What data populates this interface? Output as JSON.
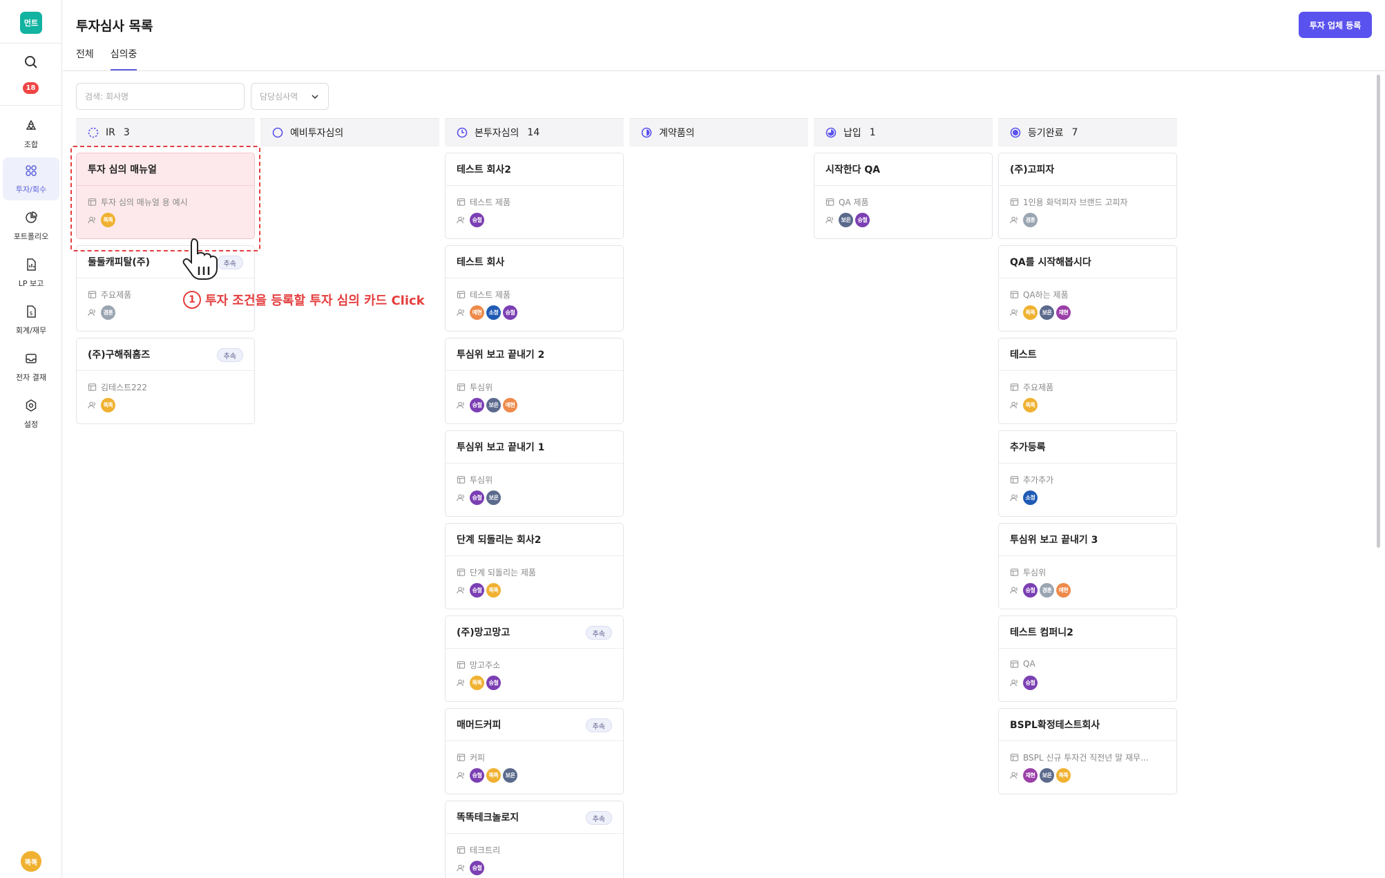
{
  "app": {
    "logo_text": "먼트",
    "notification_count": "18",
    "user_avatar": "똑똑"
  },
  "sidebar": {
    "items": [
      {
        "label": "조합",
        "icon": "recycle-icon",
        "active": false
      },
      {
        "label": "투자/회수",
        "icon": "network-icon",
        "active": true
      },
      {
        "label": "포트폴리오",
        "icon": "pie-chart-icon",
        "active": false
      },
      {
        "label": "LP 보고",
        "icon": "report-icon",
        "active": false
      },
      {
        "label": "회계/재무",
        "icon": "accounting-icon",
        "active": false
      },
      {
        "label": "전자 결재",
        "icon": "inbox-icon",
        "active": false
      },
      {
        "label": "설정",
        "icon": "gear-icon",
        "active": false
      }
    ]
  },
  "header": {
    "title": "투자심사 목록",
    "tabs": [
      {
        "label": "전체",
        "active": false
      },
      {
        "label": "심의중",
        "active": true
      }
    ],
    "primary_button": "투자 업체 등록"
  },
  "filters": {
    "search_placeholder": "검색: 회사명",
    "assignee_placeholder": "담당심사역"
  },
  "colors": {
    "accent": "#5a52ee",
    "annotation": "#e53d3d",
    "highlight_bg": "#fde9eb"
  },
  "columns": [
    {
      "name": "IR",
      "count": "3",
      "icon": "dashed-circle-icon",
      "cards": [
        {
          "title": "투자 심의 매뉴얼",
          "badge": "",
          "product": "투자 심의 매뉴얼 용 예시",
          "people": [
            "똑똑"
          ],
          "highlight": true
        },
        {
          "title": "둘둘캐피탈(주)",
          "badge": "추속",
          "product": "주요제품",
          "people": [
            "경훈"
          ],
          "highlight": false
        },
        {
          "title": "(주)구해줘홈즈",
          "badge": "추속",
          "product": "김테스트222",
          "people": [
            "똑똑"
          ],
          "highlight": false
        }
      ]
    },
    {
      "name": "예비투자심의",
      "count": "",
      "icon": "empty-circle-icon",
      "cards": []
    },
    {
      "name": "본투자심의",
      "count": "14",
      "icon": "clock-circle-icon",
      "cards": [
        {
          "title": "테스트 회사2",
          "badge": "",
          "product": "테스트 제품",
          "people": [
            "승철"
          ],
          "highlight": false
        },
        {
          "title": "테스트 회사",
          "badge": "",
          "product": "테스트 제품",
          "people": [
            "예현",
            "소정",
            "승철"
          ],
          "highlight": false
        },
        {
          "title": "투심위 보고 끝내기 2",
          "badge": "",
          "product": "투심위",
          "people": [
            "승철",
            "보은",
            "예현"
          ],
          "highlight": false
        },
        {
          "title": "투심위 보고 끝내기 1",
          "badge": "",
          "product": "투심위",
          "people": [
            "승철",
            "보은"
          ],
          "highlight": false
        },
        {
          "title": "단계 되돌리는 회사2",
          "badge": "",
          "product": "단계 되돌리는 제품",
          "people": [
            "승철",
            "똑똑"
          ],
          "highlight": false
        },
        {
          "title": "(주)망고망고",
          "badge": "추속",
          "product": "망고주소",
          "people": [
            "똑똑",
            "승철"
          ],
          "highlight": false
        },
        {
          "title": "매머드커피",
          "badge": "추속",
          "product": "커피",
          "people": [
            "승철",
            "똑똑",
            "보은"
          ],
          "highlight": false
        },
        {
          "title": "똑똑테크놀로지",
          "badge": "추속",
          "product": "테크트리",
          "people": [
            "승철"
          ],
          "highlight": false
        }
      ]
    },
    {
      "name": "계약품의",
      "count": "",
      "icon": "half-circle-icon",
      "cards": []
    },
    {
      "name": "납입",
      "count": "1",
      "icon": "three-quarter-circle-icon",
      "cards": [
        {
          "title": "시작한다 QA",
          "badge": "",
          "product": "QA 제품",
          "people": [
            "보은",
            "승철"
          ],
          "highlight": false
        }
      ]
    },
    {
      "name": "등기완료",
      "count": "7",
      "icon": "full-circle-icon",
      "cards": [
        {
          "title": "(주)고피자",
          "badge": "",
          "product": "1인용 화덕피자 브랜드 고피자",
          "people": [
            "경훈"
          ],
          "highlight": false
        },
        {
          "title": "QA를 시작해봅시다",
          "badge": "",
          "product": "QA하는 제품",
          "people": [
            "똑똑",
            "보은",
            "재현"
          ],
          "highlight": false
        },
        {
          "title": "테스트",
          "badge": "",
          "product": "주요제품",
          "people": [
            "똑똑"
          ],
          "highlight": false
        },
        {
          "title": "추가등록",
          "badge": "",
          "product": "추가추가",
          "people": [
            "소정"
          ],
          "highlight": false
        },
        {
          "title": "투심위 보고 끝내기 3",
          "badge": "",
          "product": "투심위",
          "people": [
            "승철",
            "경훈",
            "예현"
          ],
          "highlight": false
        },
        {
          "title": "테스트 컴퍼니2",
          "badge": "",
          "product": "QA",
          "people": [
            "승철"
          ],
          "highlight": false
        },
        {
          "title": "BSPL확정테스트회사",
          "badge": "",
          "product": "BSPL 신규 투자건 직전년 말 재무...",
          "people": [
            "재현",
            "보은",
            "똑똑"
          ],
          "highlight": false
        }
      ]
    }
  ],
  "people_colors": {
    "똑똑": "#f0b131",
    "경훈": "#9aa5b1",
    "승철": "#7b3fb3",
    "예현": "#ee8a4a",
    "소정": "#1f5bb5",
    "보은": "#5b6a8c",
    "재현": "#9b3fa8"
  },
  "annotation": {
    "number": "1",
    "text": "투자 조건을 등록할 투자 심의 카드 Click"
  }
}
